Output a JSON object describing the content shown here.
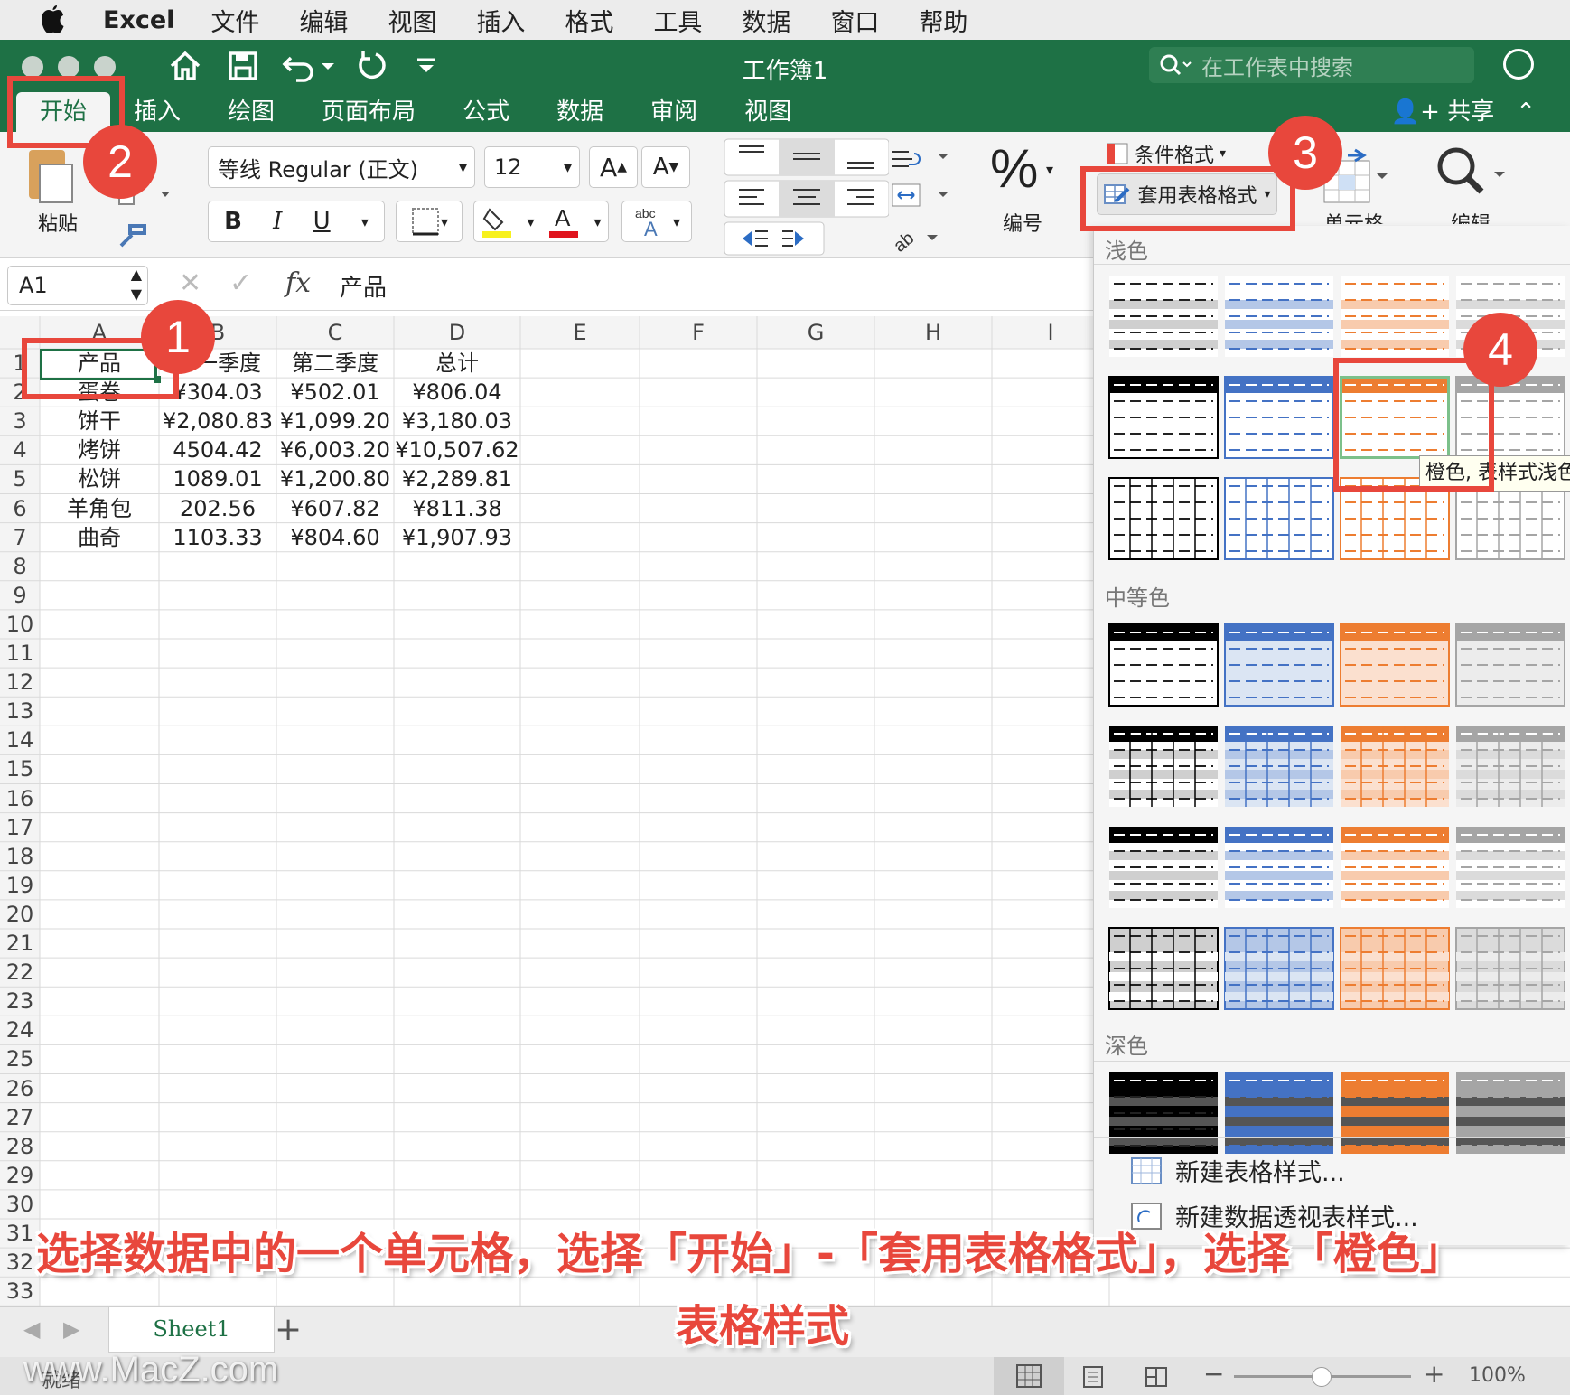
{
  "menubar": {
    "app": "Excel",
    "items": [
      "文件",
      "编辑",
      "视图",
      "插入",
      "格式",
      "工具",
      "数据",
      "窗口",
      "帮助"
    ]
  },
  "window": {
    "title": "工作簿1",
    "search_placeholder": "在工作表中搜索",
    "share": "共享"
  },
  "tabs": [
    "开始",
    "插入",
    "绘图",
    "页面布局",
    "公式",
    "数据",
    "审阅",
    "视图"
  ],
  "ribbon": {
    "paste": "粘贴",
    "font_name": "等线 Regular (正文)",
    "font_size": "12",
    "bold": "B",
    "italic": "I",
    "underline": "U",
    "number_label": "编号",
    "conditional_format": "条件格式",
    "format_as_table": "套用表格格式",
    "cells_label": "单元格",
    "edit_label": "编辑"
  },
  "formula_bar": {
    "name_box": "A1",
    "fx": "fx",
    "value": "产品"
  },
  "columns": [
    "A",
    "B",
    "C",
    "D",
    "E",
    "F",
    "G",
    "H",
    "I"
  ],
  "rows": [
    [
      "产品",
      "第一季度",
      "第二季度",
      "总计"
    ],
    [
      "蛋卷",
      "¥304.03",
      "¥502.01",
      "¥806.04"
    ],
    [
      "饼干",
      "¥2,080.83",
      "¥1,099.20",
      "¥3,180.03"
    ],
    [
      "烤饼",
      "4504.42",
      "¥6,003.20",
      "¥10,507.62"
    ],
    [
      "松饼",
      "1089.01",
      "¥1,200.80",
      "¥2,289.81"
    ],
    [
      "羊角包",
      "202.56",
      "¥607.82",
      "¥811.38"
    ],
    [
      "曲奇",
      "1103.33",
      "¥804.60",
      "¥1,907.93"
    ]
  ],
  "row_numbers": [
    "1",
    "2",
    "3",
    "4",
    "5",
    "6",
    "7",
    "8",
    "9",
    "10",
    "11",
    "12",
    "13",
    "14",
    "15",
    "16",
    "17",
    "18",
    "19",
    "20",
    "21",
    "22",
    "23",
    "24",
    "25",
    "26",
    "27",
    "28",
    "29",
    "30",
    "31",
    "32",
    "33"
  ],
  "gallery": {
    "light": "浅色",
    "medium": "中等色",
    "dark": "深色",
    "tooltip": "橙色, 表样式浅色",
    "new_table_style": "新建表格样式...",
    "new_pivot_style": "新建数据透视表样式..."
  },
  "sheet": {
    "tab": "Sheet1",
    "add": "+"
  },
  "status": {
    "ready": "就绪",
    "zoom": "100%"
  },
  "annotations": {
    "badge1": "1",
    "badge2": "2",
    "badge3": "3",
    "badge4": "4",
    "caption_line1": "选择数据中的一个单元格，选择「开始」-「套用表格格式」，选择「橙色」",
    "caption_line2": "表格样式"
  },
  "watermark": "www.MacZ.com",
  "colors": {
    "excel_green": "#1e7145",
    "annotation_red": "#e8473c",
    "orange": "#ed7d31",
    "blue": "#4472c4",
    "gray": "#a5a5a5"
  }
}
